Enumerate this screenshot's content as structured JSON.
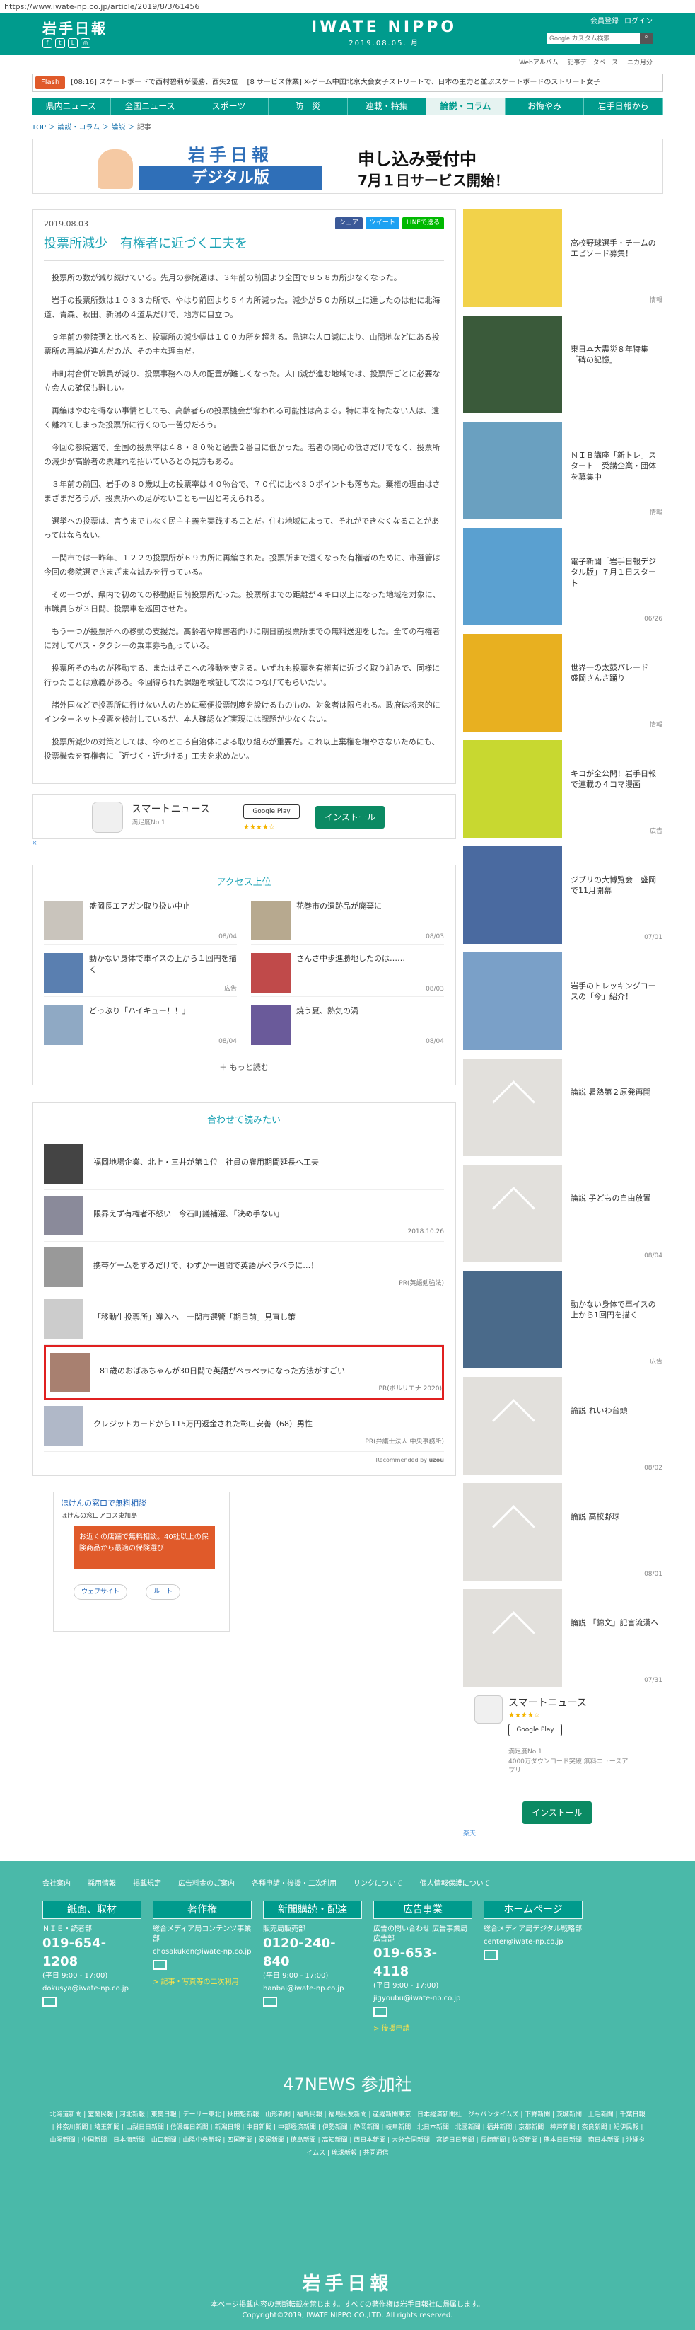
{
  "url": "https://www.iwate-np.co.jp/article/2019/8/3/61456",
  "header": {
    "logo": "岩手日報",
    "masthead": "IWATE NIPPO",
    "date": "2019.08.05. 月",
    "account": [
      "会員登録",
      "ログイン"
    ],
    "search_placeholder": "Google カスタム検索",
    "subnav": [
      "Webアルバム",
      "記事データベース",
      "ニカ月分"
    ]
  },
  "flash": {
    "tag": "Flash",
    "text": "[08:16] スケートボードで西村碧莉が優勝、西矢2位　 [8 サービス休業] X-ゲーム中国北京大会女子ストリートで、日本の主力と並ぶスケートボードのストリート女子"
  },
  "nav": [
    "県内ニュース",
    "全国ニュース",
    "スポーツ",
    "防　災",
    "連載・特集",
    "論説・コラム",
    "お悔やみ",
    "岩手日報から"
  ],
  "breadcrumb": [
    "TOP",
    "論説・コラム",
    "論説",
    "記事"
  ],
  "banner": {
    "upper": "岩手日報",
    "lower": "デジタル版",
    "line1": "申し込み受付中",
    "line2": "7月１日サービス開始！"
  },
  "article": {
    "date": "2019.08.03",
    "title": "投票所減少　有権者に近づく工夫を",
    "shares": [
      "シェア",
      "ツイート",
      "LINEで送る"
    ],
    "paragraphs": [
      "投票所の数が減り続けている。先月の参院選は、３年前の前回より全国で８５８カ所少なくなった。",
      "岩手の投票所数は１０３３カ所で、やはり前回より５４カ所減った。減少が５０カ所以上に達したのは他に北海道、青森、秋田、新潟の４道県だけで、地方に目立つ。",
      "９年前の参院選と比べると、投票所の減少幅は１００カ所を超える。急速な人口減により、山間地などにある投票所の再編が進んだのが、その主な理由だ。",
      "市町村合併で職員が減り、投票事務への人の配置が難しくなった。人口減が進む地域では、投票所ごとに必要な立会人の確保も難しい。",
      "再編はやむを得ない事情としても、高齢者らの投票機会が奪われる可能性は高まる。特に車を持たない人は、遠く離れてしまった投票所に行くのも一苦労だろう。",
      "今回の参院選で、全国の投票率は４８・８０％と過去２番目に低かった。若者の関心の低さだけでなく、投票所の減少が高齢者の票離れを招いているとの見方もある。",
      "３年前の前回、岩手の８０歳以上の投票率は４０％台で、７０代に比べ３０ポイントも落ちた。棄権の理由はさまざまだろうが、投票所への足がないことも一因と考えられる。",
      "選挙への投票は、言うまでもなく民主主義を実践することだ。住む地域によって、それができなくなることがあってはならない。",
      "一関市では一昨年、１２２の投票所が６９カ所に再編された。投票所まで遠くなった有権者のために、市選管は今回の参院選でさまざまな試みを行っている。",
      "その一つが、県内で初めての移動期日前投票所だった。投票所までの距離が４キロ以上になった地域を対象に、市職員らが３日間、投票車を巡回させた。",
      "もう一つが投票所への移動の支援だ。高齢者や障害者向けに期日前投票所までの無料送迎をした。全ての有権者に対してバス・タクシーの乗車券も配っている。",
      "投票所そのものが移動する、またはそこへの移動を支える。いずれも投票を有権者に近づく取り組みで、同様に行ったことは意義がある。今回得られた課題を検証して次につなげてもらいたい。",
      "諸外国などで投票所に行けない人のために郵便投票制度を設けるものもの、対象者は限られる。政府は将来的にインターネット投票を検討しているが、本人確認など実現には課題が少なくない。",
      "投票所減少の対策としては、今のところ自治体による取り組みが重要だ。これ以上棄権を増やさないためにも、投票機会を有権者に「近づく・近づける」工夫を求めたい。"
    ]
  },
  "app_ad": {
    "name": "スマートニュース",
    "sub": "満足度No.1",
    "google_play": "Google Play",
    "stars": "★★★★☆",
    "install": "インストール",
    "close": "×"
  },
  "ranking": {
    "heading": "アクセス上位",
    "items": [
      {
        "title": "盛岡長エアガン取り扱い中止",
        "date": "08/04"
      },
      {
        "title": "花巻市の遺跡品が廃棄に",
        "date": "08/03"
      },
      {
        "title": "動かない身体で車イスの上から１回円を描く",
        "date": "広告"
      },
      {
        "title": "さんさ中歩進勝地したのは……",
        "date": "08/03"
      },
      {
        "title": "どっぷり「ハイキュー！！」",
        "date": "08/04"
      },
      {
        "title": "焼う夏、熱気の渦",
        "date": "08/04"
      }
    ],
    "more": "もっと読む"
  },
  "related": {
    "heading": "合わせて読みたい",
    "items": [
      {
        "title": "福岡地場企業、北上・三井が第１位　社員の雇用期間延長へ工夫",
        "meta": ""
      },
      {
        "title": "限界えず有権者不怒い　今石町議補選、「決め手ない」",
        "meta": "2018.10.26"
      },
      {
        "title": "携帯ゲームをするだけで、わずか一週間で英語がペラペラに…！",
        "meta": "PR(英語勉強法)"
      },
      {
        "title": "「移動生投票所」導入へ　一関市選管「期日前」見直し策",
        "meta": ""
      },
      {
        "title": "81歳のおばあちゃんが30日間で英語がペラペラになった方法がすごい",
        "meta": "PR(ポルリエナ 2020)"
      },
      {
        "title": "クレジットカードから115万円返金された彰山安善（68）男性",
        "meta": "PR(弁護士法人 中央事務所)"
      }
    ],
    "recommend": "Recommended by"
  },
  "map_ad": {
    "title": "ほけんの窓口で無料相談",
    "sub": "ほけんの窓口アコス東加島",
    "preview": "お近くの店舗で無料相談。40社以上の保険商品から最適の保険選び",
    "buttons": [
      "ウェブサイト",
      "ルート"
    ]
  },
  "sidebar": {
    "items": [
      {
        "title": "高校野球選手・チームのエピソード募集！",
        "tag": "情報"
      },
      {
        "title": "東日本大震災８年特集「碑の記憶」",
        "tag": ""
      },
      {
        "title": "ＮＩＢ講座「新トレ」スタート　受講企業・団体を募集中",
        "tag": "情報"
      },
      {
        "title": "電子新聞「岩手日報デジタル版」７月１日スタート",
        "tag": "06/26"
      },
      {
        "title": "世界一の太鼓パレード　盛岡さんさ踊り",
        "tag": "情報"
      },
      {
        "title": "キコが全公開！岩手日報で連載の４コマ漫画",
        "tag": "広告"
      },
      {
        "title": "ジブリの大博覧会　盛岡で11月開幕",
        "tag": "07/01"
      },
      {
        "title": "岩手のトレッキングコースの「今」紹介！",
        "tag": ""
      },
      {
        "title": "論説 暑熱第２原発再開",
        "tag": ""
      },
      {
        "title": "論説 子どもの自由放置",
        "tag": "08/04"
      },
      {
        "title": "動かない身体で車イスの上から1回円を描く",
        "tag": "広告"
      },
      {
        "title": "論説 れいわ台頭",
        "tag": "08/02"
      },
      {
        "title": "論説 高校野球",
        "tag": "08/01"
      },
      {
        "title": "論説 「錦文」記言流漢へ",
        "tag": "07/31"
      }
    ],
    "app": {
      "name": "スマートニュース",
      "stars": "★★★★☆",
      "google_play": "Google Play",
      "sub1": "満足度No.1",
      "sub2": "4000万ダウンロード突破 無料ニュースアプリ",
      "install": "インストール",
      "badge": "楽天"
    }
  },
  "footer": {
    "links": [
      "会社案内",
      "採用情報",
      "掲載規定",
      "広告料金のご案内",
      "各種申請・後援・二次利用",
      "リンクについて",
      "個人情報保護について"
    ],
    "cols": [
      {
        "head": "紙面、取材",
        "sub": "ＮＩＥ・読者部",
        "tel": "019-654-1208",
        "hours": "(平日 9:00 - 17:00)",
        "mail": "dokusya@iwate-np.co.jp",
        "link": ""
      },
      {
        "head": "著作権",
        "sub": "総合メディア局コンテンツ事業部",
        "tel": "",
        "hours": "",
        "mail": "chosakuken@iwate-np.co.jp",
        "link": "> 記事・写真等の二次利用"
      },
      {
        "head": "新聞購読・配達",
        "sub": "販売局販売部",
        "tel": "0120-240-840",
        "hours": "(平日 9:00 - 17:00)",
        "mail": "hanbai@iwate-np.co.jp",
        "link": ""
      },
      {
        "head": "広告事業",
        "sub": "広告の問い合わせ 広告事業局広告部",
        "tel": "019-653-4118",
        "hours": "(平日 9:00 - 17:00)",
        "mail": "jigyoubu@iwate-np.co.jp",
        "link": "> 後援申請"
      },
      {
        "head": "ホームページ",
        "sub": "総合メディア局デジタル戦略部",
        "tel": "",
        "hours": "",
        "mail": "center@iwate-np.co.jp",
        "link": ""
      }
    ],
    "n47": "47NEWS 参加社",
    "papers": "北海道新聞 | 室蘭民報 | 河北新報 | 東奥日報 | デーリー東北 | 秋田魁新報 | 山形新聞 | 福島民報 | 福島民友新聞 | 産経新聞東京 | 日本経済新聞社 | ジャパンタイムズ | 下野新聞 | 茨城新聞 | 上毛新聞 | 千葉日報 | 神奈川新聞 | 埼玉新聞 | 山梨日日新聞 | 信濃毎日新聞 | 新潟日報 | 中日新聞 | 中部経済新聞 | 伊勢新聞 | 静岡新聞 | 岐阜新聞 | 北日本新聞 | 北國新聞 | 福井新聞 | 京都新聞 | 神戸新聞 | 奈良新聞 | 紀伊民報 | 山陽新聞 | 中国新聞 | 日本海新聞 | 山口新聞 | 山陰中央新報 | 四国新聞 | 愛媛新聞 | 徳島新聞 | 高知新聞 | 西日本新聞 | 大分合同新聞 | 宮崎日日新聞 | 長崎新聞 | 佐賀新聞 | 熊本日日新聞 | 南日本新聞 | 沖縄タイムス | 琉球新報 | 共同通信",
    "logo": "岩手日報",
    "note": "本ページ掲載内容の無断転載を禁じます。すべての著作権は岩手日報社に帰属します。",
    "copy": "Copyright©2019, IWATE NIPPO CO.,LTD. All rights reserved."
  }
}
